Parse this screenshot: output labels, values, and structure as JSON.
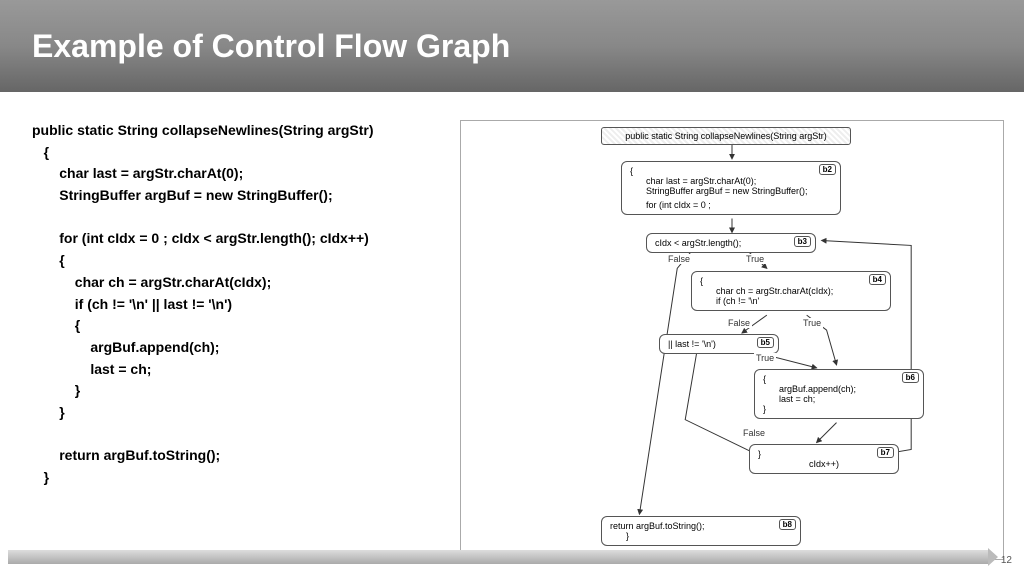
{
  "title": "Example of Control Flow Graph",
  "page_number": "12",
  "code": "public static String collapseNewlines(String argStr)\n   {\n       char last = argStr.charAt(0);\n       StringBuffer argBuf = new StringBuffer();\n\n       for (int cIdx = 0 ; cIdx < argStr.length(); cIdx++)\n       {\n           char ch = argStr.charAt(cIdx);\n           if (ch != '\\n' || last != '\\n')\n           {\n               argBuf.append(ch);\n               last = ch;\n           }\n       }\n\n       return argBuf.toString();\n   }",
  "graph": {
    "header": "public static String collapseNewlines(String argStr)",
    "b2": {
      "tag": "b2",
      "line1": "{",
      "line2": "char last = argStr.charAt(0);",
      "line3": "StringBuffer argBuf = new StringBuffer();",
      "line4": "for (int cIdx = 0 ;"
    },
    "b3": {
      "tag": "b3",
      "text": "cIdx < argStr.length();"
    },
    "b4": {
      "tag": "b4",
      "line1": "{",
      "line2": "char ch = argStr.charAt(cIdx);",
      "line3": "if (ch != '\\n'"
    },
    "b5": {
      "tag": "b5",
      "text": "|| last != '\\n')"
    },
    "b6": {
      "tag": "b6",
      "line1": "{",
      "line2": "argBuf.append(ch);",
      "line3": "last = ch;",
      "line4": "}"
    },
    "b7": {
      "tag": "b7",
      "line1": "}",
      "line2": "cIdx++)"
    },
    "b8": {
      "tag": "b8",
      "line1": "return argBuf.toString();",
      "line2": "}"
    },
    "labels": {
      "true": "True",
      "false": "False"
    }
  }
}
